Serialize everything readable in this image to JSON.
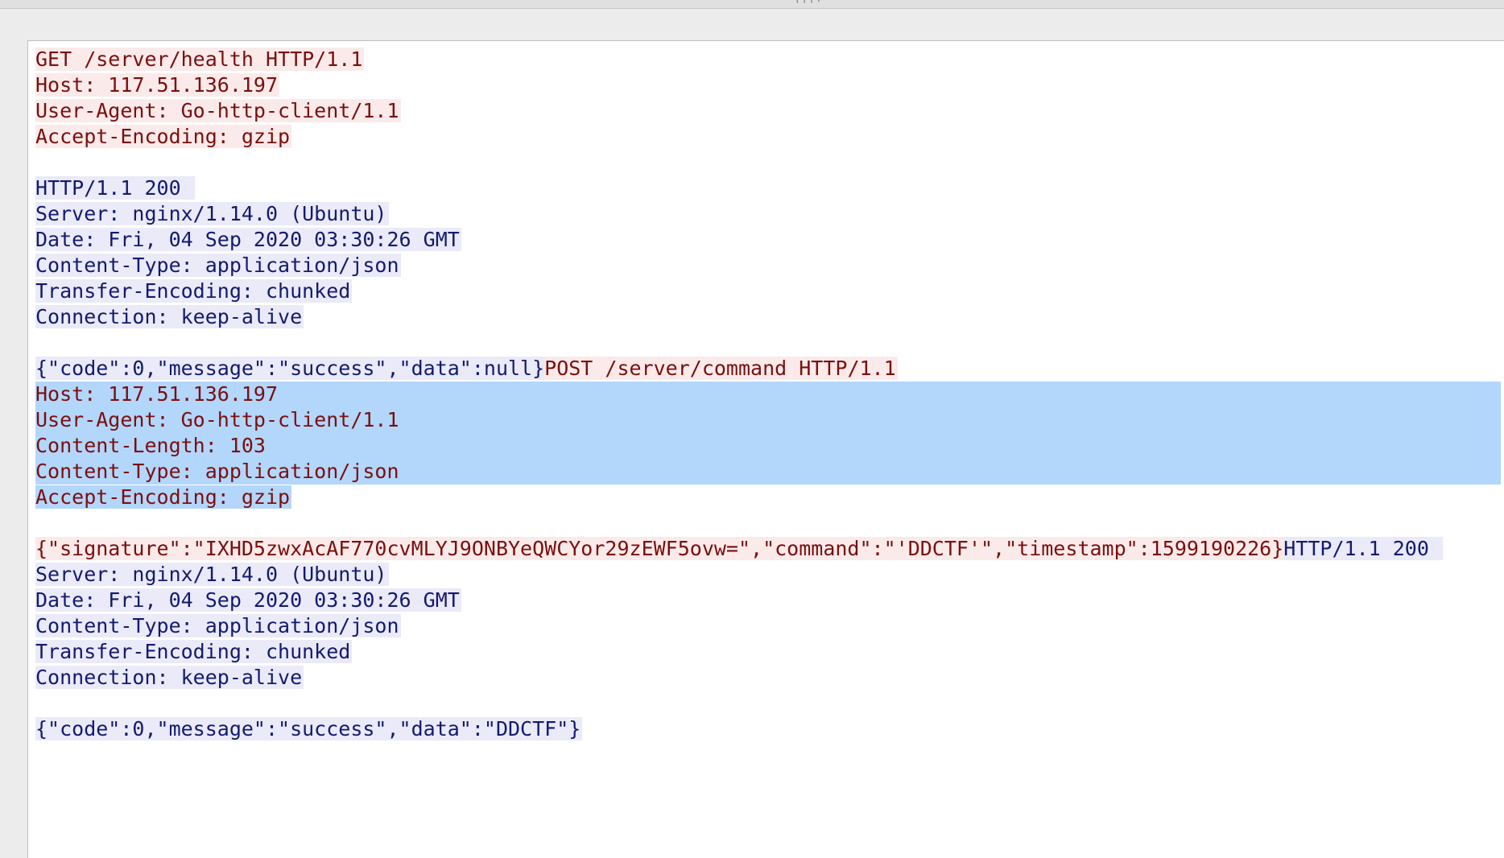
{
  "window": {
    "title_fragment": ", , , ."
  },
  "colors": {
    "client_text": "#7a0f0f",
    "client_bg": "#fbeaea",
    "server_text": "#141a6e",
    "server_bg": "#eaeaf8",
    "selection_bg": "#b3d6fb"
  },
  "stream": {
    "req1": {
      "l1": "GET /server/health HTTP/1.1",
      "l2": "Host: 117.51.136.197",
      "l3": "User-Agent: Go-http-client/1.1",
      "l4": "Accept-Encoding: gzip"
    },
    "resp1": {
      "l1": "HTTP/1.1 200 ",
      "l2": "Server: nginx/1.14.0 (Ubuntu)",
      "l3": "Date: Fri, 04 Sep 2020 03:30:26 GMT",
      "l4": "Content-Type: application/json",
      "l5": "Transfer-Encoding: chunked",
      "l6": "Connection: keep-alive",
      "body": "{\"code\":0,\"message\":\"success\",\"data\":null}"
    },
    "req2": {
      "l1": "POST /server/command HTTP/1.1",
      "l2": "Host: 117.51.136.197",
      "l3": "User-Agent: Go-http-client/1.1",
      "l4": "Content-Length: 103",
      "l5": "Content-Type: application/json",
      "l6": "Accept-Encoding: gzip",
      "body": "{\"signature\":\"IXHD5zwxAcAF770cvMLYJ9ONBYeQWCYor29zEWF5ovw=\",\"command\":\"'DDCTF'\",\"timestamp\":1599190226}"
    },
    "resp2": {
      "l1": "HTTP/1.1 200 ",
      "l2": "Server: nginx/1.14.0 (Ubuntu)",
      "l3": "Date: Fri, 04 Sep 2020 03:30:26 GMT",
      "l4": "Content-Type: application/json",
      "l5": "Transfer-Encoding: chunked",
      "l6": "Connection: keep-alive",
      "body": "{\"code\":0,\"message\":\"success\",\"data\":\"DDCTF\"}"
    }
  }
}
